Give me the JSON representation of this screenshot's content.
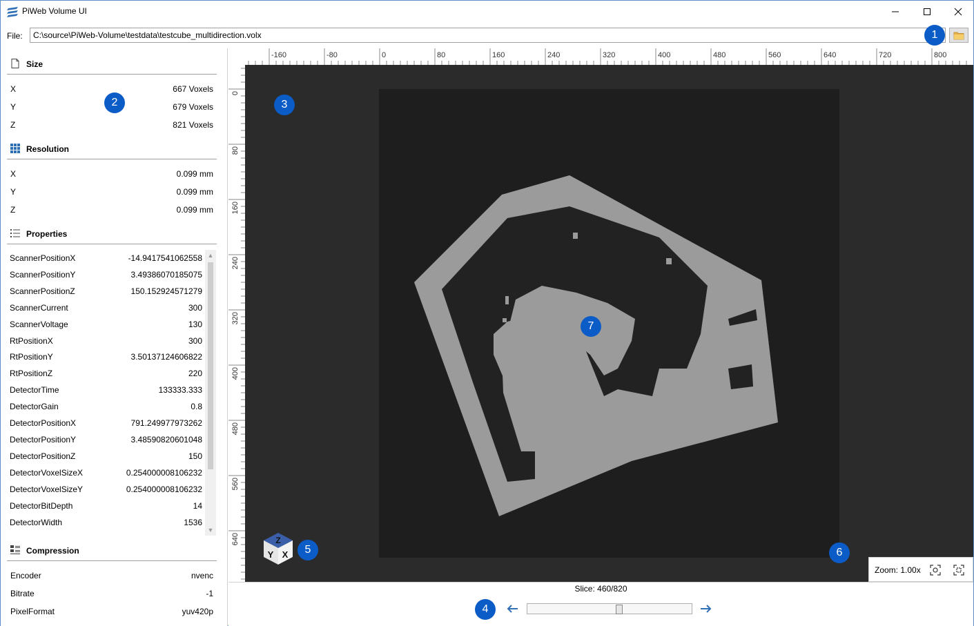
{
  "window": {
    "title": "PiWeb Volume UI",
    "accent": "#0b5cc7"
  },
  "file": {
    "label": "File:",
    "path": "C:\\source\\PiWeb-Volume\\testdata\\testcube_multidirection.volx",
    "browse_icon": "folder-icon"
  },
  "sidebar": {
    "size": {
      "title": "Size",
      "rows": [
        {
          "k": "X",
          "v": "667 Voxels"
        },
        {
          "k": "Y",
          "v": "679 Voxels"
        },
        {
          "k": "Z",
          "v": "821 Voxels"
        }
      ]
    },
    "resolution": {
      "title": "Resolution",
      "rows": [
        {
          "k": "X",
          "v": "0.099 mm"
        },
        {
          "k": "Y",
          "v": "0.099 mm"
        },
        {
          "k": "Z",
          "v": "0.099 mm"
        }
      ]
    },
    "properties": {
      "title": "Properties",
      "rows": [
        {
          "k": "ScannerPositionX",
          "v": "-14.9417541062558"
        },
        {
          "k": "ScannerPositionY",
          "v": "3.49386070185075"
        },
        {
          "k": "ScannerPositionZ",
          "v": "150.152924571279"
        },
        {
          "k": "ScannerCurrent",
          "v": "300"
        },
        {
          "k": "ScannerVoltage",
          "v": "130"
        },
        {
          "k": "RtPositionX",
          "v": "300"
        },
        {
          "k": "RtPositionY",
          "v": "3.50137124606822"
        },
        {
          "k": "RtPositionZ",
          "v": "220"
        },
        {
          "k": "DetectorTime",
          "v": "133333.333"
        },
        {
          "k": "DetectorGain",
          "v": "0.8"
        },
        {
          "k": "DetectorPositionX",
          "v": "791.249977973262"
        },
        {
          "k": "DetectorPositionY",
          "v": "3.48590820601048"
        },
        {
          "k": "DetectorPositionZ",
          "v": "150"
        },
        {
          "k": "DetectorVoxelSizeX",
          "v": "0.254000008106232"
        },
        {
          "k": "DetectorVoxelSizeY",
          "v": "0.254000008106232"
        },
        {
          "k": "DetectorBitDepth",
          "v": "14"
        },
        {
          "k": "DetectorWidth",
          "v": "1536"
        }
      ]
    },
    "compression": {
      "title": "Compression",
      "rows": [
        {
          "k": "Encoder",
          "v": "nvenc"
        },
        {
          "k": "Bitrate",
          "v": "-1"
        },
        {
          "k": "PixelFormat",
          "v": "yuv420p"
        }
      ]
    }
  },
  "rulers": {
    "h_ticks": [
      "-160",
      "-80",
      "0",
      "80",
      "160",
      "240",
      "320",
      "400",
      "480",
      "560",
      "640",
      "720",
      "800"
    ],
    "v_ticks": [
      "0",
      "80",
      "160",
      "240",
      "320",
      "400",
      "480",
      "560",
      "640"
    ]
  },
  "axis_cube": {
    "top": "Z",
    "left": "Y",
    "right": "X"
  },
  "zoom": {
    "label": "Zoom: 1.00x"
  },
  "slice": {
    "label": "Slice: 460/820",
    "current": 460,
    "max": 820
  },
  "badges": [
    "1",
    "2",
    "3",
    "4",
    "5",
    "6",
    "7"
  ]
}
